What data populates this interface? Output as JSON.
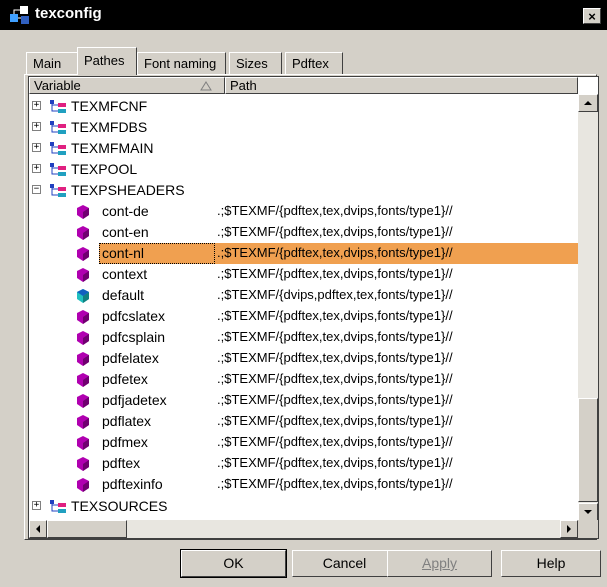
{
  "window": {
    "title": "texconfig",
    "close_label": "×"
  },
  "tabs": [
    {
      "label": "Main",
      "active": false
    },
    {
      "label": "Pathes",
      "active": true
    },
    {
      "label": "Font naming",
      "active": false
    },
    {
      "label": "Sizes",
      "active": false
    },
    {
      "label": "Pdftex",
      "active": false
    }
  ],
  "columns": {
    "variable": "Variable",
    "path": "Path"
  },
  "groups": {
    "texmfcnf": "TEXMFCNF",
    "texmfdbs": "TEXMFDBS",
    "texmfmain": "TEXMFMAIN",
    "texpool": "TEXPOOL",
    "texpsheaders": "TEXPSHEADERS",
    "texsources": "TEXSOURCES"
  },
  "expanders": {
    "collapsed": "+",
    "expanded": "−"
  },
  "children": [
    {
      "name": "cont-de",
      "path": ".;$TEXMF/{pdftex,tex,dvips,fonts/type1}//",
      "icon": "magenta-gem-icon"
    },
    {
      "name": "cont-en",
      "path": ".;$TEXMF/{pdftex,tex,dvips,fonts/type1}//",
      "icon": "magenta-gem-icon"
    },
    {
      "name": "cont-nl",
      "path": ".;$TEXMF/{pdftex,tex,dvips,fonts/type1}//",
      "icon": "magenta-gem-icon",
      "selected": true
    },
    {
      "name": "context",
      "path": ".;$TEXMF/{pdftex,tex,dvips,fonts/type1}//",
      "icon": "magenta-gem-icon"
    },
    {
      "name": "default",
      "path": ".;$TEXMF/{dvips,pdftex,tex,fonts/type1}//",
      "icon": "cyan-gem-icon"
    },
    {
      "name": "pdfcslatex",
      "path": ".;$TEXMF/{pdftex,tex,dvips,fonts/type1}//",
      "icon": "magenta-gem-icon"
    },
    {
      "name": "pdfcsplain",
      "path": ".;$TEXMF/{pdftex,tex,dvips,fonts/type1}//",
      "icon": "magenta-gem-icon"
    },
    {
      "name": "pdfelatex",
      "path": ".;$TEXMF/{pdftex,tex,dvips,fonts/type1}//",
      "icon": "magenta-gem-icon"
    },
    {
      "name": "pdfetex",
      "path": ".;$TEXMF/{pdftex,tex,dvips,fonts/type1}//",
      "icon": "magenta-gem-icon"
    },
    {
      "name": "pdfjadetex",
      "path": ".;$TEXMF/{pdftex,tex,dvips,fonts/type1}//",
      "icon": "magenta-gem-icon"
    },
    {
      "name": "pdflatex",
      "path": ".;$TEXMF/{pdftex,tex,dvips,fonts/type1}//",
      "icon": "magenta-gem-icon"
    },
    {
      "name": "pdfmex",
      "path": ".;$TEXMF/{pdftex,tex,dvips,fonts/type1}//",
      "icon": "magenta-gem-icon"
    },
    {
      "name": "pdftex",
      "path": ".;$TEXMF/{pdftex,tex,dvips,fonts/type1}//",
      "icon": "magenta-gem-icon"
    },
    {
      "name": "pdftexinfo",
      "path": ".;$TEXMF/{pdftex,tex,dvips,fonts/type1}//",
      "icon": "magenta-gem-icon"
    }
  ],
  "buttons": {
    "ok": "OK",
    "cancel": "Cancel",
    "apply": "Apply",
    "help": "Help"
  },
  "colors": {
    "selection": "#f0a050",
    "magenta_icon": "#b000b0",
    "cyan_icon": "#20c0c0",
    "titlebar": "#000000"
  }
}
